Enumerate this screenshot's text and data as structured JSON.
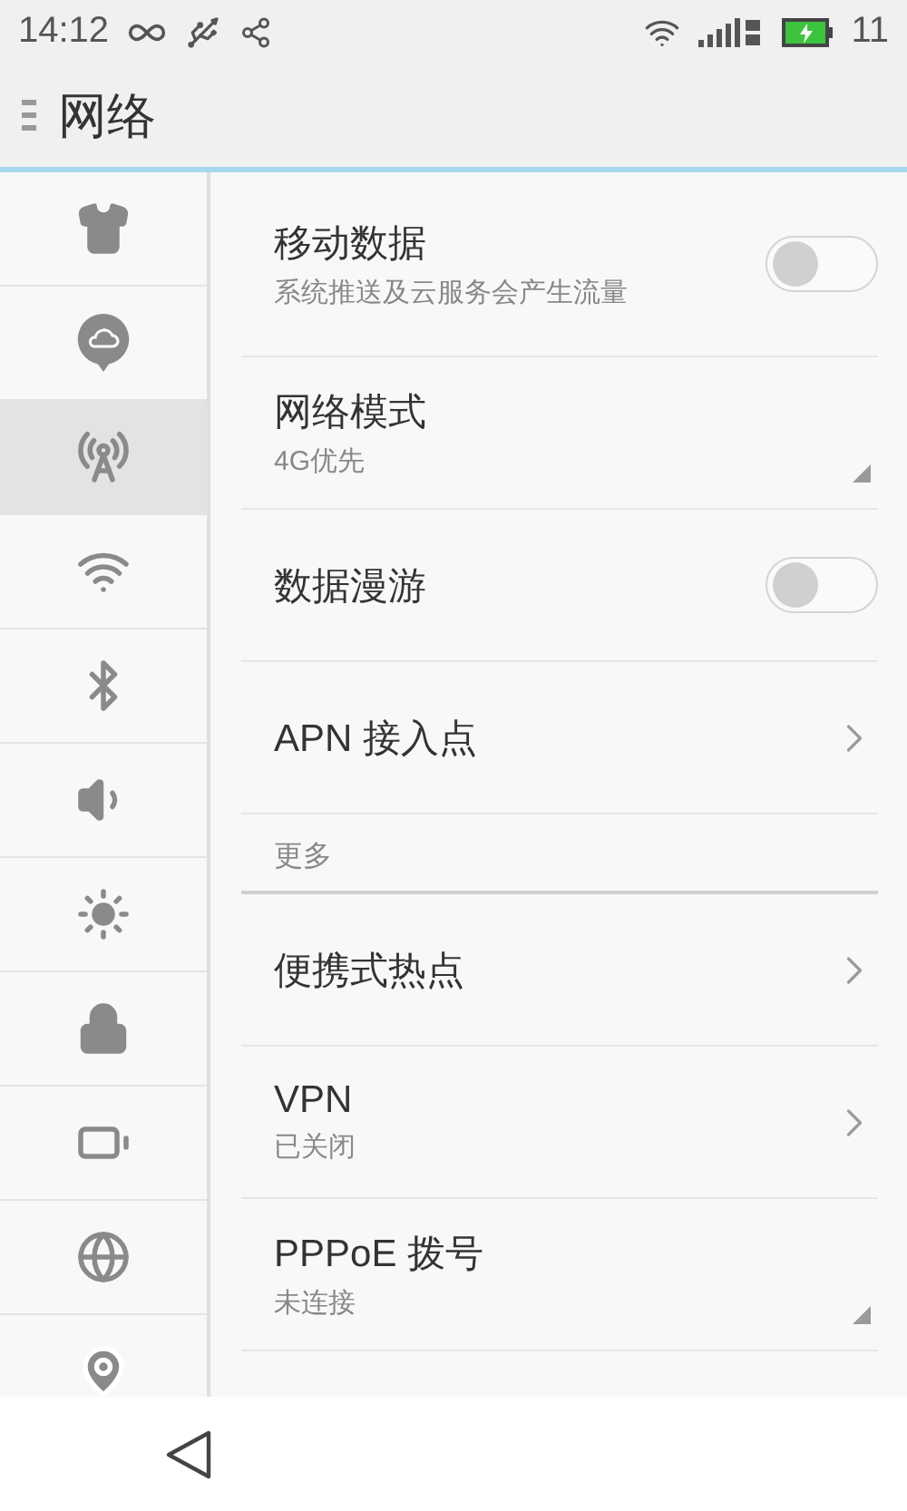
{
  "status_bar": {
    "time": "14:12",
    "battery_text": "11"
  },
  "header": {
    "title": "网络"
  },
  "sidebar": {
    "items": [
      {
        "kind": "shirt",
        "selected": false
      },
      {
        "kind": "cloud",
        "selected": false
      },
      {
        "kind": "antenna",
        "selected": true
      },
      {
        "kind": "wifi",
        "selected": false
      },
      {
        "kind": "bluetooth",
        "selected": false
      },
      {
        "kind": "sound",
        "selected": false
      },
      {
        "kind": "brightness",
        "selected": false
      },
      {
        "kind": "lock",
        "selected": false
      },
      {
        "kind": "battery",
        "selected": false
      },
      {
        "kind": "globe",
        "selected": false
      },
      {
        "kind": "location",
        "selected": false
      }
    ]
  },
  "settings": [
    {
      "kind": "toggle",
      "title": "移动数据",
      "subtitle": "系统推送及云服务会产生流量",
      "on": false
    },
    {
      "kind": "dropdown",
      "title": "网络模式",
      "subtitle": "4G优先"
    },
    {
      "kind": "toggle",
      "title": "数据漫游",
      "on": false
    },
    {
      "kind": "link",
      "title": "APN 接入点"
    },
    {
      "kind": "section",
      "title": "更多"
    },
    {
      "kind": "link",
      "title": "便携式热点"
    },
    {
      "kind": "link",
      "title": "VPN",
      "subtitle": "已关闭"
    },
    {
      "kind": "dropdown",
      "title": "PPPoE 拨号",
      "subtitle": "未连接"
    }
  ]
}
